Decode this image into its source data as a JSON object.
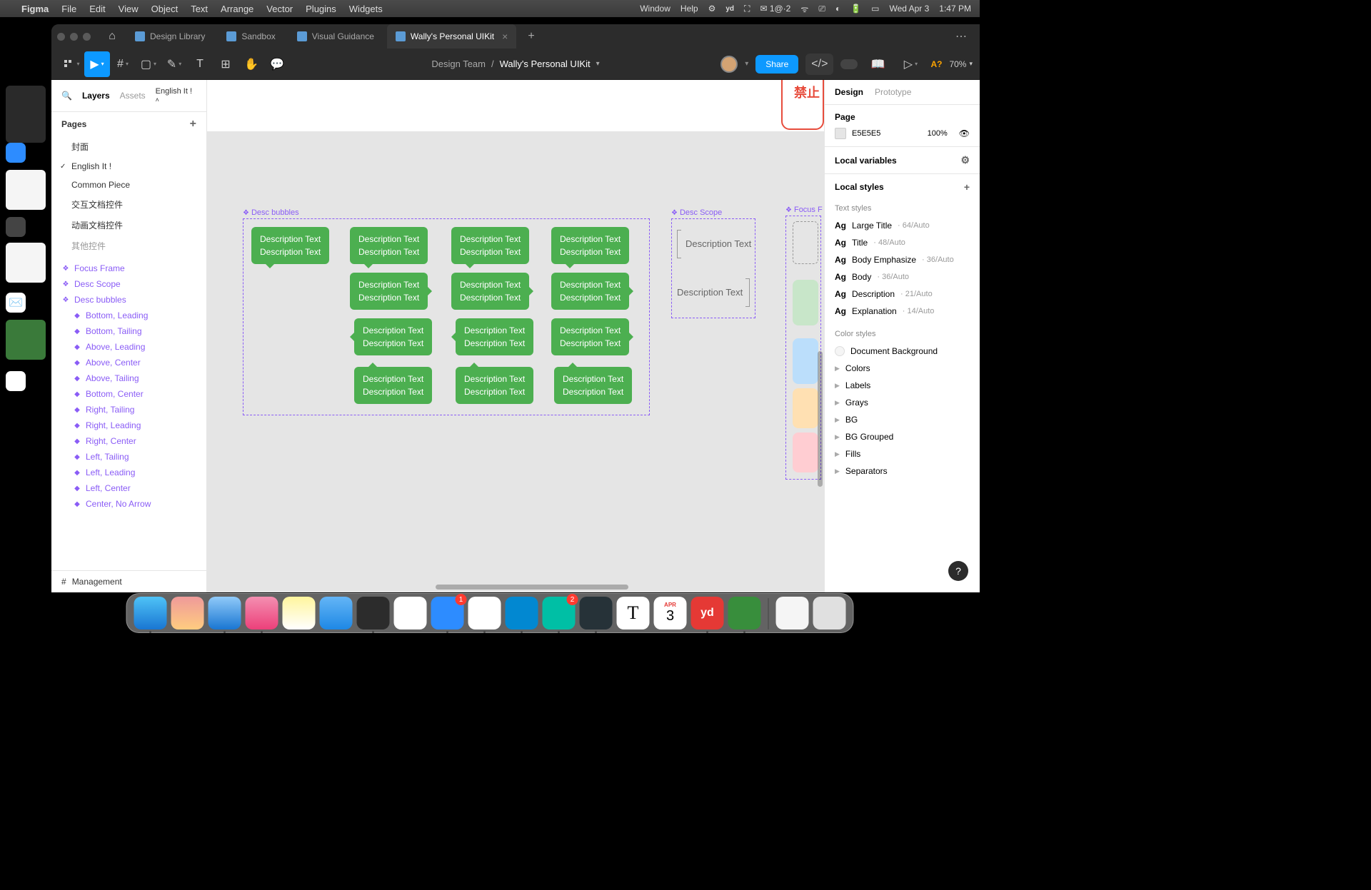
{
  "menubar": {
    "app": "Figma",
    "items": [
      "File",
      "Edit",
      "View",
      "Object",
      "Text",
      "Arrange",
      "Vector",
      "Plugins",
      "Widgets"
    ],
    "right": [
      "Window",
      "Help"
    ],
    "status_mail": "1@·2",
    "date": "Wed Apr 3",
    "time": "1:47 PM"
  },
  "tabs": [
    {
      "label": "Design Library",
      "active": false
    },
    {
      "label": "Sandbox",
      "active": false
    },
    {
      "label": "Visual Guidance",
      "active": false
    },
    {
      "label": "Wally's Personal UIKit",
      "active": true
    }
  ],
  "toolbar": {
    "team": "Design Team",
    "file": "Wally's Personal UIKit",
    "share": "Share",
    "zoom": "70%",
    "a_label": "A?"
  },
  "left": {
    "search_icon": "search",
    "tabs": {
      "layers": "Layers",
      "assets": "Assets"
    },
    "lang": "English It !",
    "pages_label": "Pages",
    "pages": [
      "封面",
      "English It !",
      "Common Piece",
      "交互文档控件",
      "动画文档控件",
      "其他控件"
    ],
    "frames": [
      "Focus Frame",
      "Desc Scope",
      "Desc bubbles"
    ],
    "bubble_layers": [
      "Bottom, Leading",
      "Bottom, Tailing",
      "Above, Leading",
      "Above, Center",
      "Above, Tailing",
      "Bottom, Center",
      "Right, Tailing",
      "Right, Leading",
      "Right, Center",
      "Left, Tailing",
      "Left, Leading",
      "Left, Center",
      "Center, No Arrow"
    ],
    "bottom": "Management"
  },
  "canvas": {
    "frames": {
      "bubbles": "Desc bubbles",
      "scope": "Desc Scope",
      "focus": "Focus F"
    },
    "bubble_line1": "Description Text",
    "bubble_line2": "Description Text",
    "scope_text": "Description Text",
    "red_text": "禁止"
  },
  "right": {
    "tabs": {
      "design": "Design",
      "prototype": "Prototype"
    },
    "page_label": "Page",
    "page_hex": "E5E5E5",
    "page_opacity": "100%",
    "local_vars": "Local variables",
    "local_styles": "Local styles",
    "text_styles_label": "Text styles",
    "text_styles": [
      {
        "name": "Large Title",
        "meta": "64/Auto"
      },
      {
        "name": "Title",
        "meta": "48/Auto"
      },
      {
        "name": "Body Emphasize",
        "meta": "36/Auto"
      },
      {
        "name": "Body",
        "meta": "36/Auto"
      },
      {
        "name": "Description",
        "meta": "21/Auto"
      },
      {
        "name": "Explanation",
        "meta": "14/Auto"
      }
    ],
    "color_styles_label": "Color styles",
    "doc_bg": "Document Background",
    "color_groups": [
      "Colors",
      "Labels",
      "Grays",
      "BG",
      "BG Grouped",
      "Fills",
      "Separators"
    ]
  },
  "dock": {
    "cal_month": "APR",
    "cal_day": "3",
    "zoom_badge": "1",
    "vscode_badge": "2"
  }
}
